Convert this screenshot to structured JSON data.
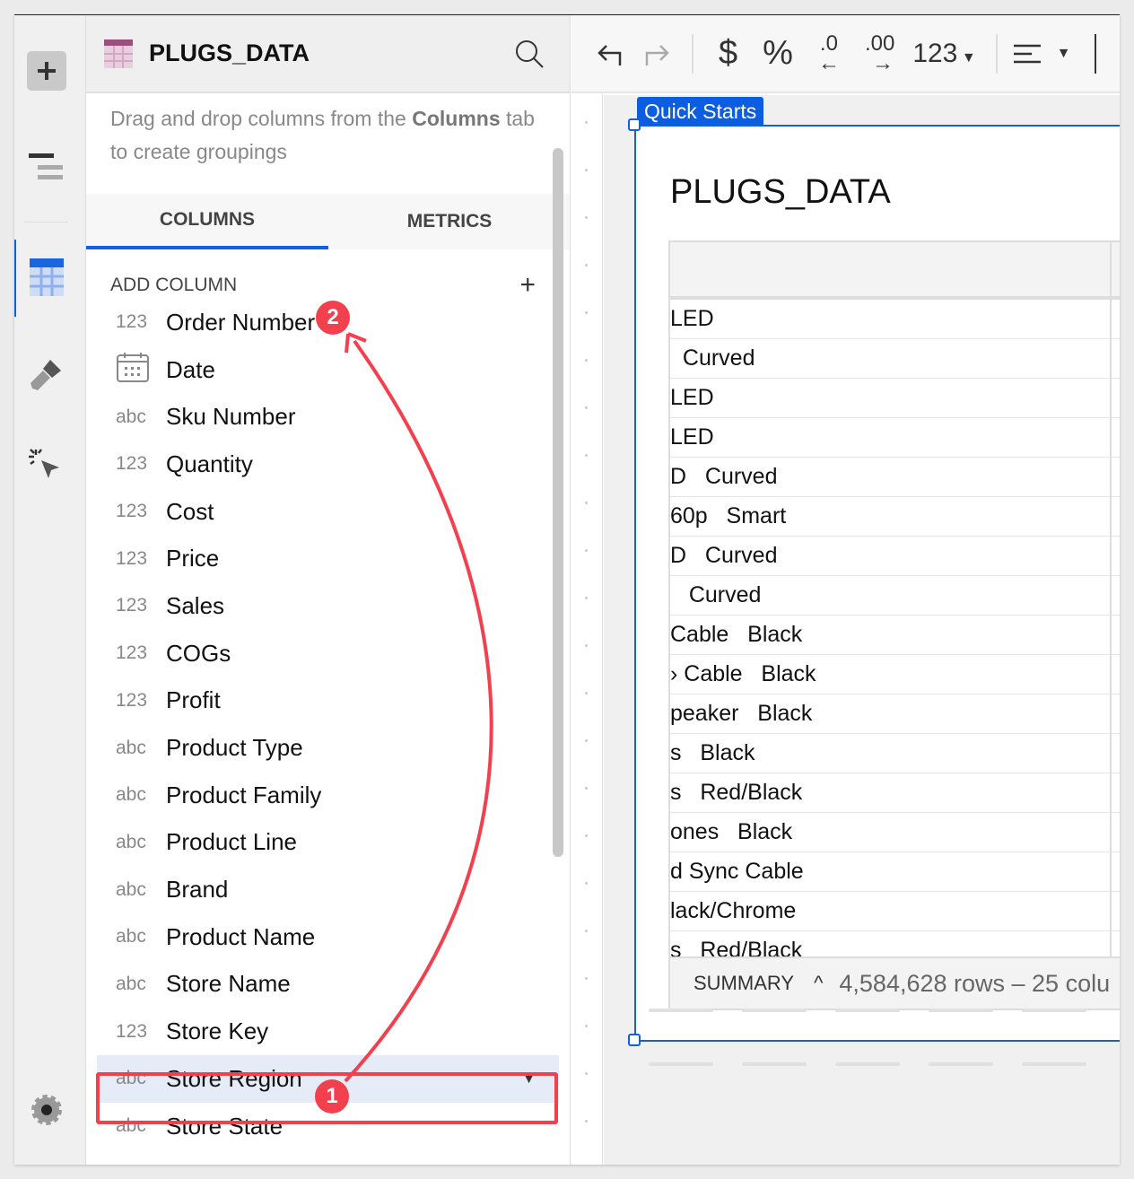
{
  "panel": {
    "title": "PLUGS_DATA",
    "hint_pre": "Drag and drop columns from the ",
    "hint_bold": "Columns",
    "hint_post": " tab to create groupings",
    "tabs": [
      "COLUMNS",
      "METRICS"
    ],
    "add_column": "ADD COLUMN",
    "columns": [
      {
        "type": "123",
        "name": "Order Number"
      },
      {
        "type": "date",
        "name": "Date"
      },
      {
        "type": "abc",
        "name": "Sku Number"
      },
      {
        "type": "123",
        "name": "Quantity"
      },
      {
        "type": "123",
        "name": "Cost"
      },
      {
        "type": "123",
        "name": "Price"
      },
      {
        "type": "123",
        "name": "Sales"
      },
      {
        "type": "123",
        "name": "COGs"
      },
      {
        "type": "123",
        "name": "Profit"
      },
      {
        "type": "abc",
        "name": "Product Type"
      },
      {
        "type": "abc",
        "name": "Product Family"
      },
      {
        "type": "abc",
        "name": "Product Line"
      },
      {
        "type": "abc",
        "name": "Brand"
      },
      {
        "type": "abc",
        "name": "Product Name"
      },
      {
        "type": "abc",
        "name": "Store Name"
      },
      {
        "type": "123",
        "name": "Store Key"
      },
      {
        "type": "abc",
        "name": "Store Region"
      },
      {
        "type": "abc",
        "name": "Store State"
      }
    ],
    "selected": "Store Region"
  },
  "toolbar": {
    "dollar": "$",
    "percent": "%",
    "dec_less": ".0",
    "dec_more": ".00",
    "number_format": "123"
  },
  "canvas": {
    "tag": "Quick Starts",
    "title": "PLUGS_DATA",
    "rows": [
      "LED",
      "  Curved",
      "LED",
      "LED",
      "D   Curved",
      "60p   Smart",
      "D   Curved",
      "   Curved",
      "Cable   Black",
      "› Cable   Black",
      "peaker   Black",
      "s   Black",
      "s   Red/Black",
      "ones   Black",
      "d Sync Cable",
      "lack/Chrome",
      "s   Red/Black"
    ],
    "summary_label": "SUMMARY",
    "summary_count": "4,584,628 rows – 25 colu"
  },
  "annotations": {
    "step1": "1",
    "step2": "2"
  },
  "colors": {
    "accent": "#1060e0",
    "annotation": "#f2404e"
  }
}
